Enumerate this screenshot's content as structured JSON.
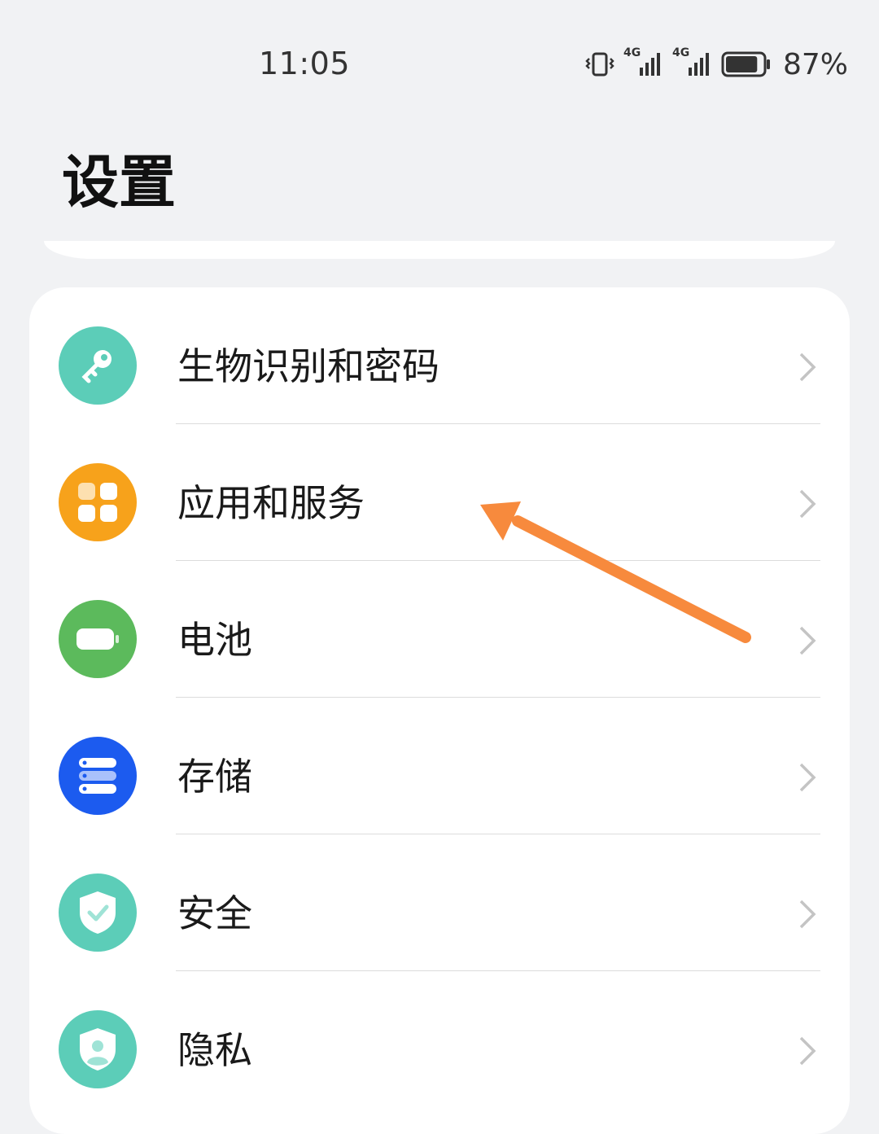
{
  "status_bar": {
    "time": "11:05",
    "network_1": "4G",
    "network_2": "4G",
    "battery_percent": "87%",
    "battery_level": 0.87,
    "icons": [
      "vibrate-icon",
      "signal-icon",
      "signal-icon",
      "battery-icon"
    ]
  },
  "page": {
    "title": "设置"
  },
  "settings": {
    "items": [
      {
        "label": "生物识别和密码",
        "icon": "key-icon",
        "color": "#5ccdb8"
      },
      {
        "label": "应用和服务",
        "icon": "apps-icon",
        "color": "#f7a21b"
      },
      {
        "label": "电池",
        "icon": "battery-icon",
        "color": "#5cba5c"
      },
      {
        "label": "存储",
        "icon": "storage-icon",
        "color": "#1c5bef"
      },
      {
        "label": "安全",
        "icon": "shield-icon",
        "color": "#5ccdb8"
      },
      {
        "label": "隐私",
        "icon": "privacy-icon",
        "color": "#5ccdb8"
      }
    ]
  },
  "annotation": {
    "icon": "arrow-icon",
    "color": "#f78a3d"
  }
}
